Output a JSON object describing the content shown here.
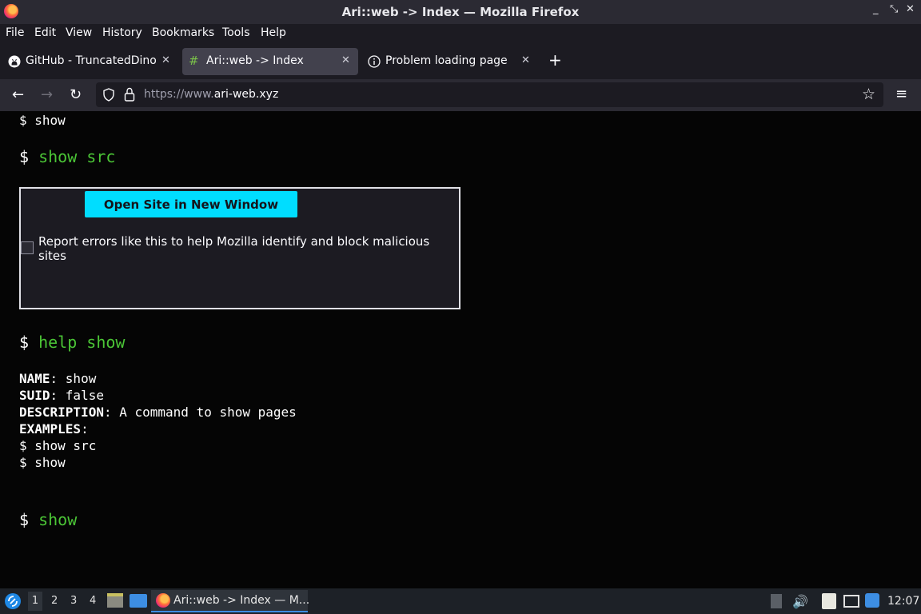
{
  "window": {
    "title": "Ari::web -> Index — Mozilla Firefox"
  },
  "menu": [
    "File",
    "Edit",
    "View",
    "History",
    "Bookmarks",
    "Tools",
    "Help"
  ],
  "tabs": [
    {
      "label": "GitHub - TruncatedDinos",
      "icon": "github-icon",
      "active": false
    },
    {
      "label": "Ari::web -> Index",
      "icon": "hash-icon",
      "active": true
    },
    {
      "label": "Problem loading page",
      "icon": "info-icon",
      "active": false
    }
  ],
  "nav": {
    "url_prefix": "https://www.",
    "url_domain": "ari-web.xyz"
  },
  "content": {
    "line1_prompt": "$",
    "line1_cmd": "show",
    "line2_prompt": "$",
    "line2_cmd": "show src",
    "error_box": {
      "button_label": "Open Site in New Window",
      "report_text": "Report errors like this to help Mozilla identify and block malicious sites",
      "report_checked": false
    },
    "line3_prompt": "$",
    "line3_cmd": "help show",
    "help": {
      "name_key": "NAME",
      "name_val": "show",
      "suid_key": "SUID",
      "suid_val": "false",
      "desc_key": "DESCRIPTION",
      "desc_val": "A command to show pages",
      "examples_key": "EXAMPLES",
      "example1": "$ show src",
      "example2": "$ show"
    },
    "line4_prompt": "$",
    "line4_cmd": "show"
  },
  "taskbar": {
    "workspaces": [
      "1",
      "2",
      "3",
      "4"
    ],
    "active_workspace": "1",
    "task_label": "Ari::web -> Index — M...",
    "clock": "12:07"
  },
  "colors": {
    "accent_cyan": "#00ddff",
    "terminal_green": "#4bc536"
  }
}
